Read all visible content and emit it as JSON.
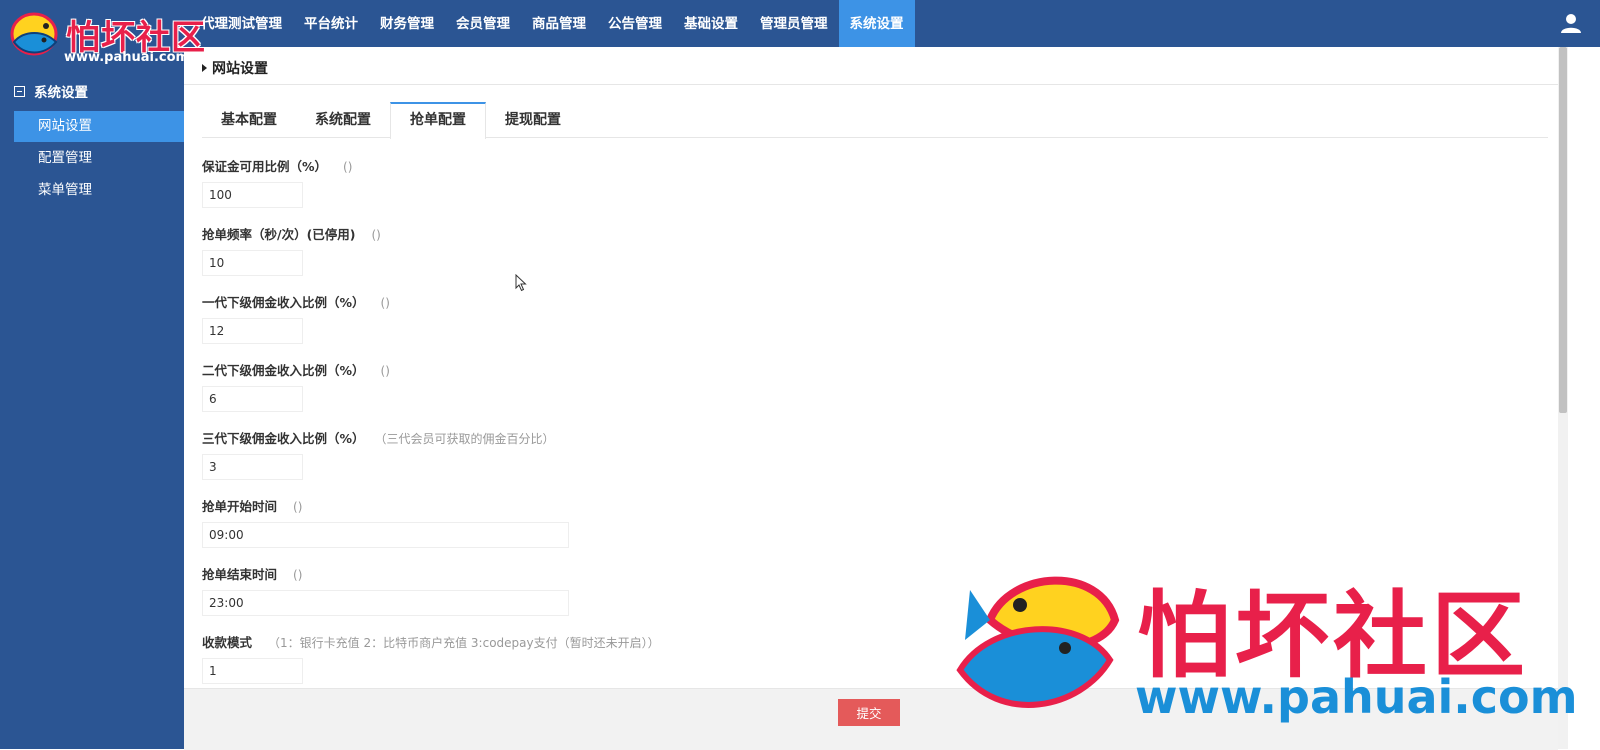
{
  "logo": {
    "name": "怕坏社区",
    "url": "www.pahuai.com"
  },
  "nav": [
    {
      "label": "代理测试管理"
    },
    {
      "label": "平台统计"
    },
    {
      "label": "财务管理"
    },
    {
      "label": "会员管理"
    },
    {
      "label": "商品管理"
    },
    {
      "label": "公告管理"
    },
    {
      "label": "基础设置"
    },
    {
      "label": "管理员管理"
    },
    {
      "label": "系统设置",
      "active": true
    }
  ],
  "sidebar": {
    "group": "系统设置",
    "items": [
      {
        "label": "网站设置",
        "active": true
      },
      {
        "label": "配置管理"
      },
      {
        "label": "菜单管理"
      }
    ]
  },
  "page": {
    "title": "网站设置"
  },
  "tabs": [
    {
      "label": "基本配置"
    },
    {
      "label": "系统配置"
    },
    {
      "label": "抢单配置",
      "active": true
    },
    {
      "label": "提现配置"
    }
  ],
  "fields": [
    {
      "label": "保证金可用比例（%）",
      "hint": "()",
      "value": "100"
    },
    {
      "label": "抢单频率（秒/次）(已停用)",
      "hint": "()",
      "value": "10"
    },
    {
      "label": "一代下级佣金收入比例（%）",
      "hint": "()",
      "value": "12"
    },
    {
      "label": "二代下级佣金收入比例（%）",
      "hint": "()",
      "value": "6"
    },
    {
      "label": "三代下级佣金收入比例（%）",
      "hint": "（三代会员可获取的佣金百分比）",
      "value": "3"
    },
    {
      "label": "抢单开始时间",
      "hint": "()",
      "value": "09:00"
    },
    {
      "label": "抢单结束时间",
      "hint": "()",
      "value": "23:00"
    },
    {
      "label": "收款模式",
      "hint": "（1：银行卡充值 2：比特币商户充值 3:codepay支付（暂时还未开启））",
      "value": "1"
    }
  ],
  "footer": {
    "submit_label": "提交"
  },
  "watermark": {
    "name": "怕坏社区",
    "url": "www.pahuai.com"
  },
  "colors": {
    "nav_bg": "#2b5593",
    "active_bg": "#3d93e6",
    "submit_bg": "#e45a5a",
    "brand_red": "#e8204a",
    "brand_blue": "#1a8fd8"
  }
}
